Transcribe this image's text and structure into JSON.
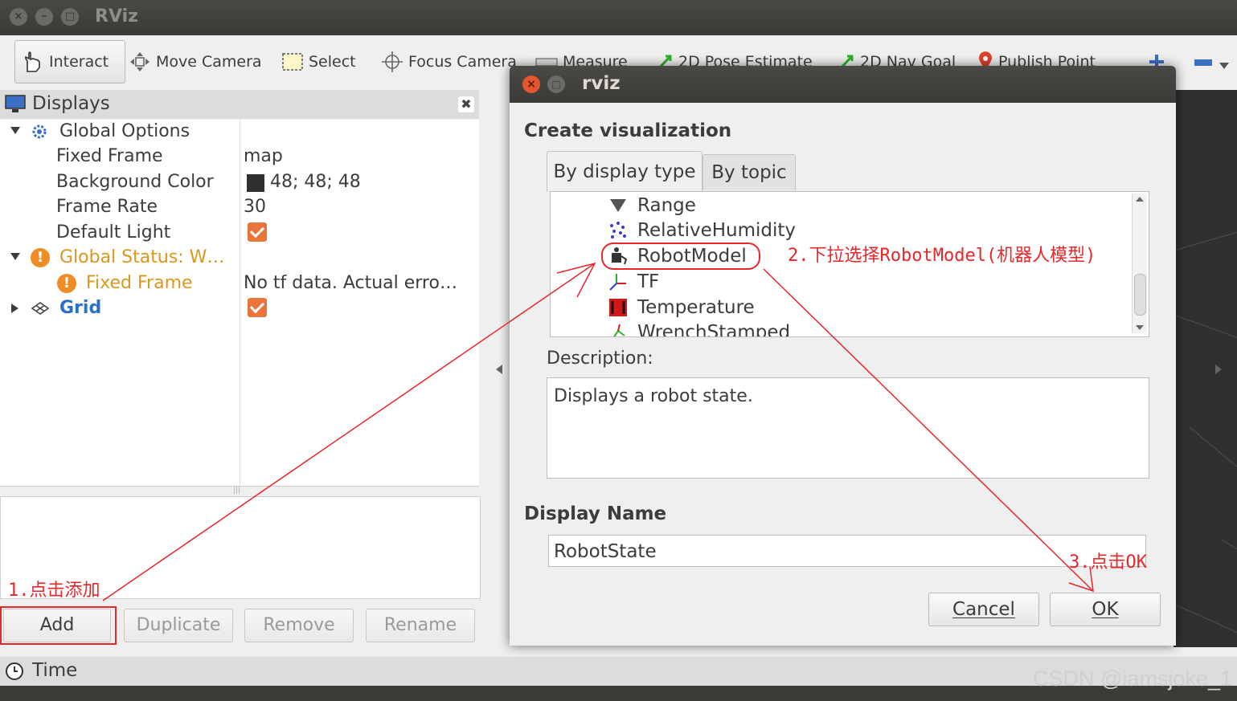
{
  "window": {
    "title": "RViz"
  },
  "toolbar": {
    "tools": [
      {
        "label": "Interact",
        "icon": "hand-pointer-icon"
      },
      {
        "label": "Move Camera",
        "icon": "move-camera-icon"
      },
      {
        "label": "Select",
        "icon": "select-box-icon"
      },
      {
        "label": "Focus Camera",
        "icon": "focus-camera-icon"
      },
      {
        "label": "Measure",
        "icon": "ruler-icon"
      },
      {
        "label": "2D Pose Estimate",
        "icon": "green-arrow-icon"
      },
      {
        "label": "2D Nav Goal",
        "icon": "green-arrow-icon"
      },
      {
        "label": "Publish Point",
        "icon": "map-pin-icon"
      }
    ]
  },
  "displays": {
    "title": "Displays",
    "rows": {
      "global_options": "Global Options",
      "fixed_frame": {
        "label": "Fixed Frame",
        "value": "map"
      },
      "background_color": {
        "label": "Background Color",
        "value": "48; 48; 48",
        "swatch": "#303030"
      },
      "frame_rate": {
        "label": "Frame Rate",
        "value": "30"
      },
      "default_light": {
        "label": "Default Light",
        "checked": true
      },
      "global_status": "Global Status: W…",
      "status_fixed_frame": {
        "label": "Fixed Frame",
        "value": "No tf data.  Actual erro…"
      },
      "grid": {
        "label": "Grid",
        "checked": true
      }
    },
    "buttons": {
      "add": "Add",
      "duplicate": "Duplicate",
      "remove": "Remove",
      "rename": "Rename"
    }
  },
  "time_panel": {
    "title": "Time"
  },
  "dialog": {
    "title": "rviz",
    "heading": "Create visualization",
    "tabs": [
      "By display type",
      "By topic"
    ],
    "list_items": [
      "Range",
      "RelativeHumidity",
      "RobotModel",
      "TF",
      "Temperature",
      "WrenchStamped"
    ],
    "selected": "RobotModel",
    "description_label": "Description:",
    "description": "Displays a robot state.",
    "display_name_label": "Display Name",
    "display_name_value": "RobotState",
    "cancel": "Cancel",
    "ok": "OK"
  },
  "annotations": {
    "step1": "1.点击添加",
    "step2": "2.下拉选择RobotModel(机器人模型)",
    "step3": "3.点击OK",
    "color": "#e8272a"
  },
  "watermark": "CSDN @iamsjoke_1"
}
